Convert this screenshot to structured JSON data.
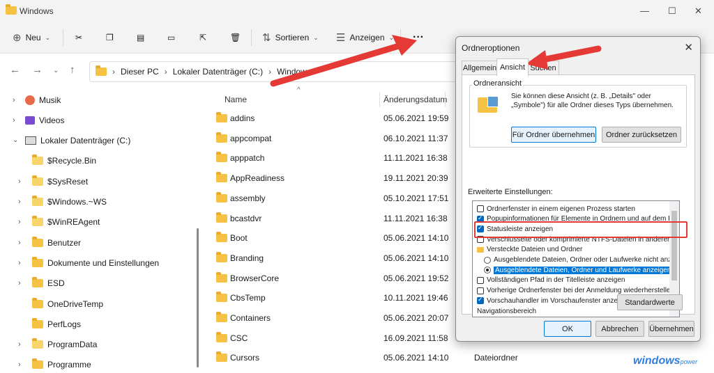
{
  "window": {
    "title": "Windows",
    "controls": [
      "—",
      "☐",
      "✕"
    ]
  },
  "toolbar": {
    "new_label": "Neu",
    "sort_label": "Sortieren",
    "view_label": "Anzeigen",
    "more_label": "···"
  },
  "address": {
    "crumbs": [
      "Dieser PC",
      "Lokaler Datenträger (C:)",
      "Windows"
    ]
  },
  "sidebar": {
    "items": [
      {
        "label": "Musik"
      },
      {
        "label": "Videos"
      },
      {
        "label": "Lokaler Datenträger (C:)"
      },
      {
        "label": "$Recycle.Bin"
      },
      {
        "label": "$SysReset"
      },
      {
        "label": "$Windows.~WS"
      },
      {
        "label": "$WinREAgent"
      },
      {
        "label": "Benutzer"
      },
      {
        "label": "Dokumente und Einstellungen"
      },
      {
        "label": "ESD"
      },
      {
        "label": "OneDriveTemp"
      },
      {
        "label": "PerfLogs"
      },
      {
        "label": "ProgramData"
      },
      {
        "label": "Programme"
      }
    ]
  },
  "files": {
    "headers": {
      "name": "Name",
      "date": "Änderungsdatum"
    },
    "rows": [
      {
        "name": "addins",
        "date": "05.06.2021 19:59",
        "type": ""
      },
      {
        "name": "appcompat",
        "date": "06.10.2021 11:37",
        "type": ""
      },
      {
        "name": "apppatch",
        "date": "11.11.2021 16:38",
        "type": ""
      },
      {
        "name": "AppReadiness",
        "date": "19.11.2021 20:39",
        "type": ""
      },
      {
        "name": "assembly",
        "date": "05.10.2021 17:51",
        "type": ""
      },
      {
        "name": "bcastdvr",
        "date": "11.11.2021 16:38",
        "type": ""
      },
      {
        "name": "Boot",
        "date": "05.06.2021 14:10",
        "type": ""
      },
      {
        "name": "Branding",
        "date": "05.06.2021 14:10",
        "type": ""
      },
      {
        "name": "BrowserCore",
        "date": "05.06.2021 19:52",
        "type": ""
      },
      {
        "name": "CbsTemp",
        "date": "10.11.2021 19:46",
        "type": ""
      },
      {
        "name": "Containers",
        "date": "05.06.2021 20:07",
        "type": ""
      },
      {
        "name": "CSC",
        "date": "16.09.2021 11:58",
        "type": ""
      },
      {
        "name": "Cursors",
        "date": "05.06.2021 14:10",
        "type": "Dateiordner"
      }
    ]
  },
  "dialog": {
    "title": "Ordneroptionen",
    "close": "✕",
    "tabs": [
      "Allgemein",
      "Ansicht",
      "Suchen"
    ],
    "group_label": "Ordneransicht",
    "group_text": "Sie können diese Ansicht (z. B. „Details\" oder „Symbole\") für alle Ordner dieses Typs übernehmen.",
    "apply_all": "Für Ordner übernehmen",
    "reset_folders": "Ordner zurücksetzen",
    "advanced_label": "Erweiterte Einstellungen:",
    "settings": [
      {
        "kind": "check",
        "on": false,
        "label": "Ordnerfenster in einem eigenen Prozess starten"
      },
      {
        "kind": "check",
        "on": true,
        "label": "Popupinformationen für Elemente in Ordnern und auf dem Des"
      },
      {
        "kind": "check",
        "on": true,
        "label": "Statusleiste anzeigen"
      },
      {
        "kind": "check",
        "on": false,
        "label": "Verschlüsselte oder komprimierte NTFS-Dateien in anderer Fa"
      },
      {
        "kind": "folder",
        "on": false,
        "label": "Versteckte Dateien und Ordner"
      },
      {
        "kind": "radio",
        "on": false,
        "label": "Ausgeblendete Dateien, Ordner oder Laufwerke nicht anz"
      },
      {
        "kind": "radio",
        "on": true,
        "label": "Ausgeblendete Dateien, Ordner und Laufwerke anzeigen"
      },
      {
        "kind": "check",
        "on": false,
        "label": "Vollständigen Pfad in der Titelleiste anzeigen"
      },
      {
        "kind": "check",
        "on": false,
        "label": "Vorherige Ordnerfenster bei der Anmeldung wiederherstellen"
      },
      {
        "kind": "check",
        "on": true,
        "label": "Vorschauhandler im Vorschaufenster anzeigen"
      },
      {
        "kind": "none",
        "on": false,
        "label": "Navigationsbereich"
      }
    ],
    "defaults": "Standardwerte",
    "ok": "OK",
    "cancel": "Abbrechen",
    "apply": "Übernehmen"
  },
  "brand": {
    "name": "windows",
    "suffix": "power"
  },
  "colors": {
    "accent": "#0078d7",
    "folder": "#f6c244",
    "callout": "#e53935"
  }
}
